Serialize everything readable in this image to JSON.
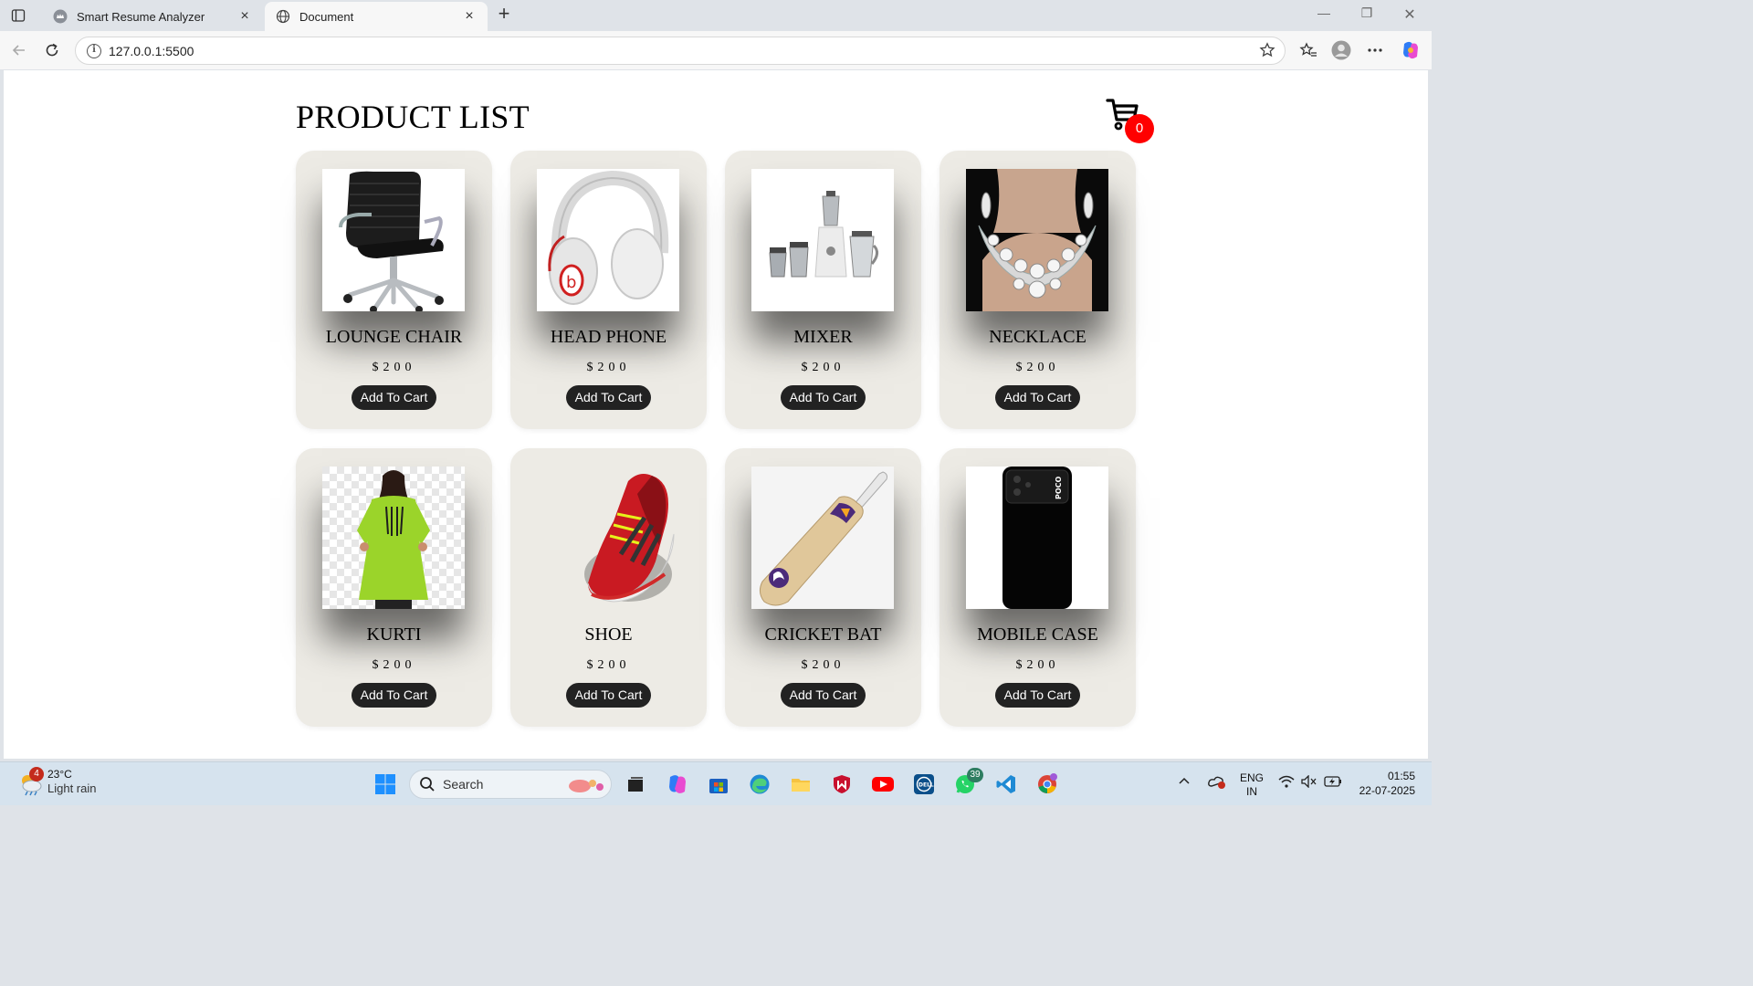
{
  "browser": {
    "tabs": [
      {
        "title": "Smart Resume Analyzer",
        "active": false
      },
      {
        "title": "Document",
        "active": true
      }
    ],
    "address": "127.0.0.1:5500"
  },
  "page": {
    "title": "PRODUCT LIST",
    "cart_count": "0",
    "products": [
      {
        "name": "LOUNGE CHAIR",
        "price": "$200",
        "button": "Add To Cart",
        "image": "office-chair"
      },
      {
        "name": "HEAD PHONE",
        "price": "$200",
        "button": "Add To Cart",
        "image": "headphones"
      },
      {
        "name": "MIXER",
        "price": "$200",
        "button": "Add To Cart",
        "image": "mixer-grinder"
      },
      {
        "name": "NECKLACE",
        "price": "$200",
        "button": "Add To Cart",
        "image": "necklace"
      },
      {
        "name": "KURTI",
        "price": "$200",
        "button": "Add To Cart",
        "image": "kurti"
      },
      {
        "name": "SHOE",
        "price": "$200",
        "button": "Add To Cart",
        "image": "shoe"
      },
      {
        "name": "CRICKET BAT",
        "price": "$200",
        "button": "Add To Cart",
        "image": "cricket-bat"
      },
      {
        "name": "MOBILE CASE",
        "price": "$200",
        "button": "Add To Cart",
        "image": "mobile-case"
      }
    ]
  },
  "taskbar": {
    "weather": {
      "temp": "23°C",
      "condition": "Light rain",
      "badge": "4"
    },
    "search_placeholder": "Search",
    "whatsapp_badge": "39",
    "language": {
      "line1": "ENG",
      "line2": "IN"
    },
    "clock": {
      "time": "01:55",
      "date": "22-07-2025"
    }
  },
  "colors": {
    "card_bg": "#edebe5",
    "button_bg": "#222222",
    "badge_red": "#ff0000",
    "taskbar_bg": "#d6e3ee"
  }
}
